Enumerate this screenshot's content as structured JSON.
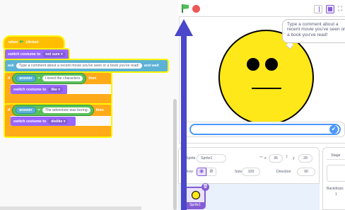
{
  "code": {
    "hat": {
      "when": "when",
      "clicked": "clicked"
    },
    "switch_costume_1": {
      "label": "switch costume to",
      "value": "not sure"
    },
    "ask": {
      "label": "ask",
      "text": "Type a comment about a recent movie you've seen or a book you've read!",
      "and_wait": "and wait"
    },
    "if_1": {
      "if": "if",
      "answer": "answer",
      "equals": "=",
      "value": "I loved the characters",
      "then": "then",
      "switch_label": "switch costume to",
      "switch_value": "like"
    },
    "if_2": {
      "if": "if",
      "answer": "answer",
      "equals": "=",
      "value": "The adventure was boring",
      "then": "then",
      "switch_label": "switch costume to",
      "switch_value": "dislike"
    }
  },
  "stage": {
    "speech_bubble": "Type a comment about a recent movie you've seen or a book you've read!",
    "ask_input_value": "",
    "submit_icon": "check-icon",
    "fullscreen_glyph": "⛶"
  },
  "sprite_info": {
    "sprite_label": "Sprite",
    "sprite_name": "Sprite1",
    "x_label": "x",
    "x_value": "36",
    "y_label": "y",
    "y_value": "28",
    "show_label": "Show",
    "size_label": "Size",
    "size_value": "100",
    "direction_label": "Direction",
    "direction_value": "90",
    "arrows_glyph": "↔",
    "updown_glyph": "↕",
    "eye_glyph": "◉",
    "eye_off_glyph": "⊘"
  },
  "sprites": [
    {
      "name": "Sprite1",
      "selected": true
    }
  ],
  "stage_pane": {
    "tab_label": "Stage",
    "backdrops_label": "Backdrops",
    "backdrops_count": "1"
  },
  "colors": {
    "events": "#ffbf00",
    "looks": "#9966ff",
    "sensing": "#5cb1d6",
    "control": "#ffab19",
    "operators": "#59c059",
    "highlight": "#fff700",
    "arrow": "#4a47ca",
    "face": "#ffe81a"
  }
}
